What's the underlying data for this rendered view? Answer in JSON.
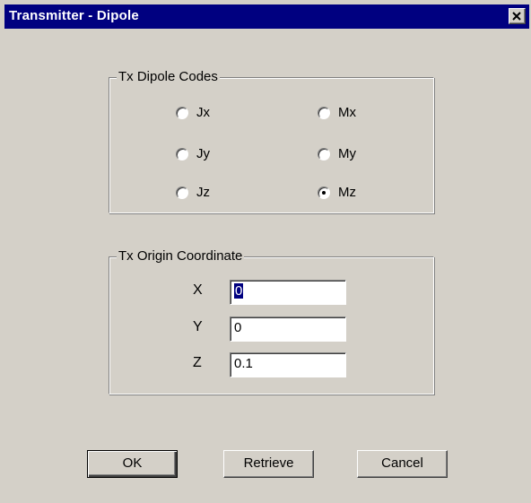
{
  "window": {
    "title": "Transmitter - Dipole"
  },
  "dipole_group": {
    "label": "Tx Dipole Codes",
    "options": [
      {
        "label": "Jx",
        "checked": false
      },
      {
        "label": "Mx",
        "checked": false
      },
      {
        "label": "Jy",
        "checked": false
      },
      {
        "label": "My",
        "checked": false
      },
      {
        "label": "Jz",
        "checked": false
      },
      {
        "label": "Mz",
        "checked": true
      }
    ]
  },
  "origin_group": {
    "label": "Tx Origin Coordinate",
    "x_label": "X",
    "x_value": "0",
    "y_label": "Y",
    "y_value": "0",
    "z_label": "Z",
    "z_value": "0.1"
  },
  "buttons": {
    "ok": "OK",
    "retrieve": "Retrieve",
    "cancel": "Cancel"
  },
  "colors": {
    "titlebar": "#000080",
    "face": "#d4d0c8"
  },
  "icons": {
    "close": "close-icon"
  }
}
